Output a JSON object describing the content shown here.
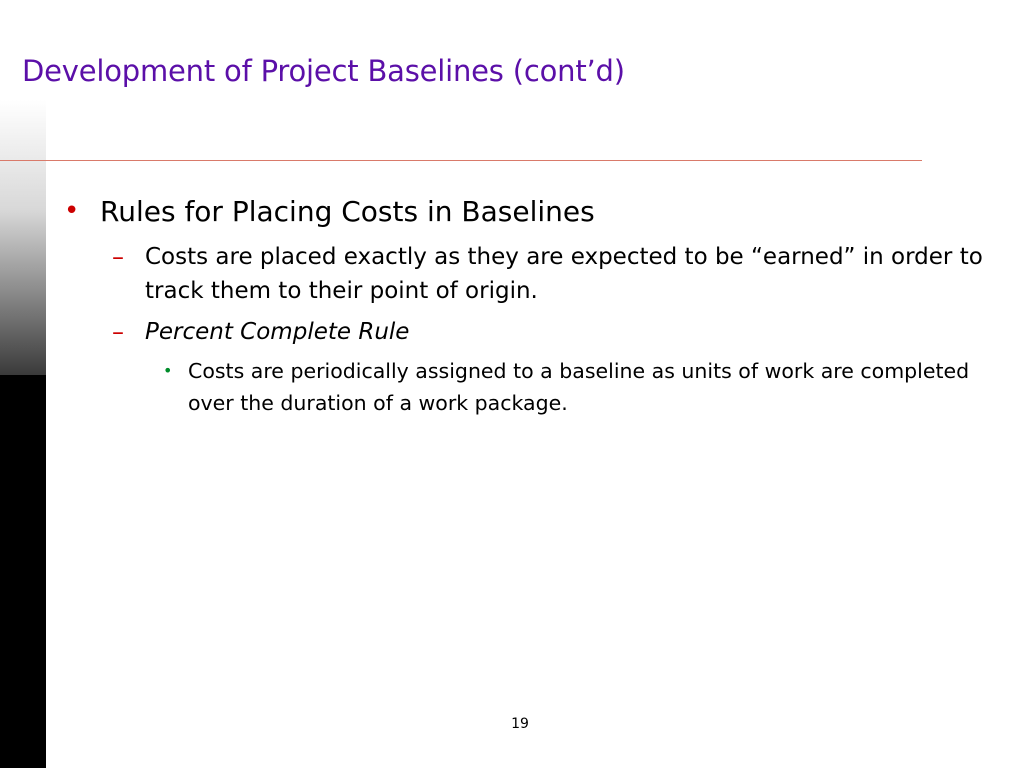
{
  "slide": {
    "title": "Development of Project Baselines (cont’d)",
    "page_number": "19",
    "colors": {
      "title": "#5b0fa8",
      "rule": "#d97a6a",
      "bullet_level1": "#cc0000",
      "bullet_level2": "#cc0000",
      "bullet_level3": "#008c2a"
    },
    "bullets": {
      "level1": {
        "marker": "•",
        "text": "Rules for Placing Costs in Baselines"
      },
      "level2": [
        {
          "marker": "–",
          "text": "Costs are placed exactly as they are expected to be “earned” in order to track them to their point of origin."
        },
        {
          "marker": "–",
          "text": "Percent Complete Rule"
        }
      ],
      "level3": {
        "marker": "•",
        "text": "Costs are periodically assigned to a baseline  as units of work are completed over the duration of a work package."
      }
    }
  }
}
